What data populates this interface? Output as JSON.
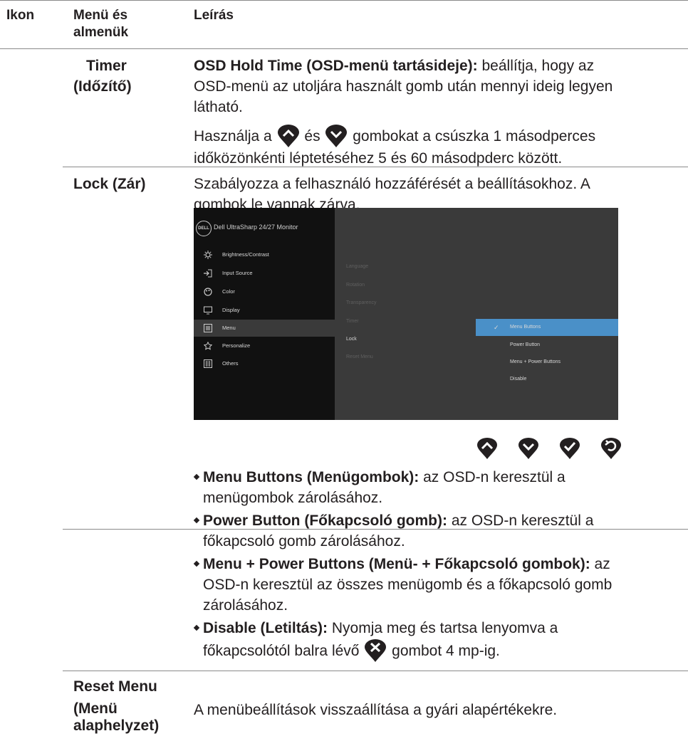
{
  "header": {
    "col_icon": "Ikon",
    "col_menu": "Menü és almenük",
    "col_desc": "Leírás"
  },
  "rows": {
    "timer": {
      "name": "Timer (Időzítő)",
      "name_line1": "Timer",
      "name_line2": "(Időzítő)",
      "hold_bold": "OSD Hold Time (OSD-menü tartásideje):",
      "hold_text": " beállítja, hogy az",
      "hold_line2": "OSD-menü az utoljára használt gomb után mennyi ideig legyen",
      "hold_line3": "látható.",
      "use_pre": "Használja a ",
      "use_mid": " és ",
      "use_post": " gombokat a csúszka 1 másodperces",
      "use_line2": "időközönkénti léptetéséhez 5 és 60 másodpderc között."
    },
    "lock": {
      "name": "Lock (Zár)",
      "line1": "Szabályozza a felhasználó hozzáférését a beállításokhoz. A",
      "line2": "gombok le vannak zárva."
    },
    "reset": {
      "name_line1": "Reset Menu",
      "name_line2": "(Menü",
      "name_line3": "alaphelyzet)",
      "desc": "A menübeállítások visszaállítása a gyári alapértékekre."
    }
  },
  "osd": {
    "logo": "DELL",
    "title": "Dell UltraSharp 24/27 Monitor",
    "menu": [
      {
        "label": "Brightness/Contrast",
        "icon": "brightness-icon"
      },
      {
        "label": "Input Source",
        "icon": "input-source-icon"
      },
      {
        "label": "Color",
        "icon": "color-icon"
      },
      {
        "label": "Display",
        "icon": "display-icon"
      },
      {
        "label": "Menu",
        "icon": "menu-icon"
      },
      {
        "label": "Personalize",
        "icon": "star-icon"
      },
      {
        "label": "Others",
        "icon": "others-icon"
      }
    ],
    "submenu": [
      "Language",
      "Rotation",
      "Transparency",
      "Timer",
      "Lock",
      "Reset Menu"
    ],
    "options": [
      "Menu Buttons",
      "Power Button",
      "Menu + Power Buttons",
      "Disable"
    ],
    "checkmark": "✓",
    "selected_color": "#4a90c8"
  },
  "bullets": [
    {
      "bold": "Menu Buttons (Menügombok):",
      "text": " az OSD-n keresztül a",
      "line2": "menügombok zárolásához."
    },
    {
      "bold": "Power Button (Főkapcsoló gomb):",
      "text": " az OSD-n keresztül a",
      "line2": "főkapcsoló gomb zárolásához."
    },
    {
      "bold": "Menu + Power Buttons (Menü- + Főkapcsoló gombok):",
      "text": " az",
      "line2": "OSD-n keresztül az összes menügomb és a főkapcsoló gomb",
      "line3": "zárolásához."
    },
    {
      "bold": "Disable (Letiltás):",
      "text": " Nyomja meg és tartsa lenyomva a",
      "line2_pre": "főkapcsolótól balra lévő ",
      "line2_post": " gombot 4 mp-ig."
    }
  ]
}
